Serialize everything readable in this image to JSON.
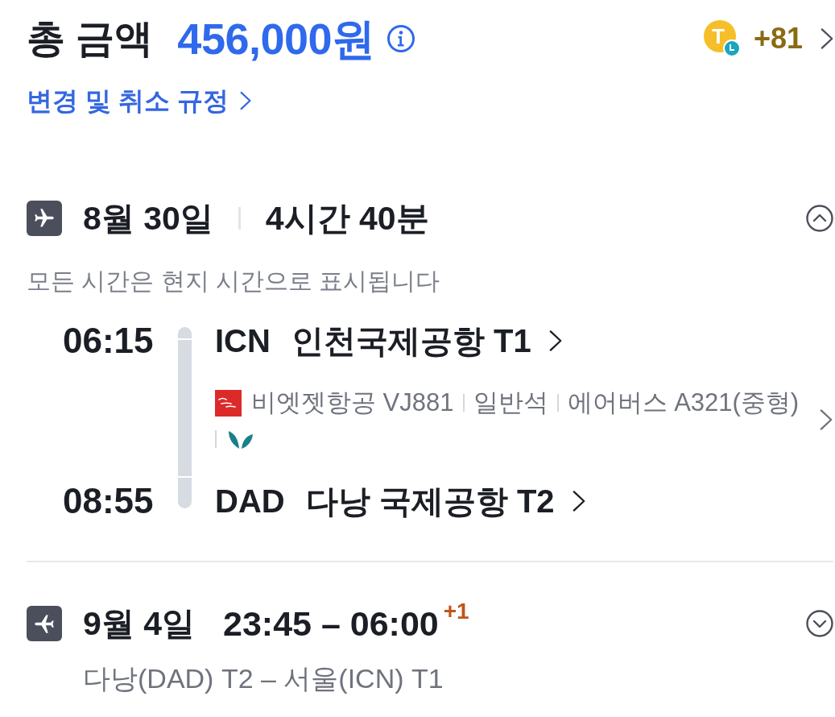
{
  "total": {
    "label": "총 금액",
    "amount": "456,000원"
  },
  "points": {
    "coin_letter": "T",
    "value": "+81"
  },
  "policy_link": {
    "label": "변경 및 취소 규정"
  },
  "legs": [
    {
      "kind": "detailed",
      "return_leg": false,
      "expanded": true,
      "date": "8월 30일",
      "duration": "4시간 40분",
      "note": "모든 시간은 현지 시간으로 표시됩니다",
      "departure": {
        "time": "06:15",
        "code": "ICN",
        "airport": "인천국제공항 T1"
      },
      "flight_info": [
        "비엣젯항공 VJ881",
        "일반석",
        "에어버스 A321(중형)"
      ],
      "arrival": {
        "time": "08:55",
        "code": "DAD",
        "airport": "다낭 국제공항 T2"
      }
    },
    {
      "kind": "summary",
      "return_leg": true,
      "expanded": false,
      "date": "9월 4일",
      "time_range": "23:45 – 06:00",
      "day_offset": "+1",
      "route": "다낭(DAD) T2 – 서울(ICN) T1"
    }
  ]
}
